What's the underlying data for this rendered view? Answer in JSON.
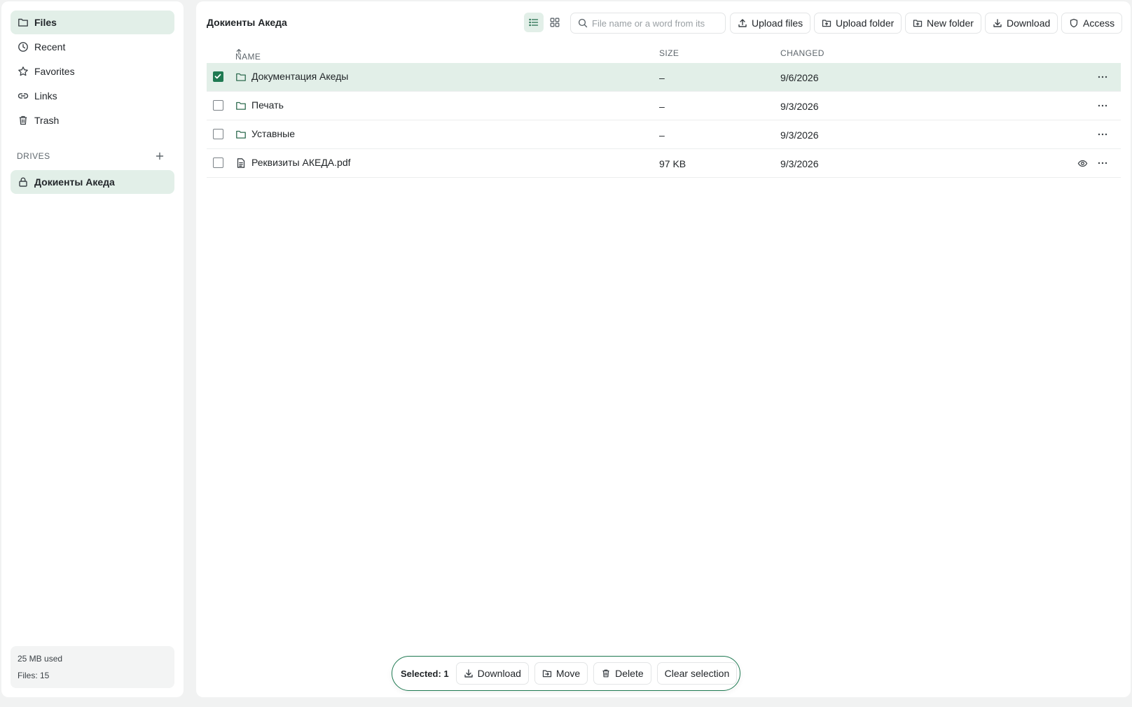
{
  "sidebar": {
    "nav": [
      {
        "label": "Files",
        "icon": "folder-icon",
        "active": true
      },
      {
        "label": "Recent",
        "icon": "clock-icon",
        "active": false
      },
      {
        "label": "Favorites",
        "icon": "star-icon",
        "active": false
      },
      {
        "label": "Links",
        "icon": "link-icon",
        "active": false
      },
      {
        "label": "Trash",
        "icon": "trash-icon",
        "active": false
      }
    ],
    "drives_label": "DRIVES",
    "drives": [
      {
        "label": "Докиенты Акеда",
        "icon": "lock-icon",
        "active": true
      }
    ],
    "storage": {
      "used": "25 MB used",
      "files": "Files: 15"
    }
  },
  "main": {
    "title": "Докиенты Акеда",
    "search_placeholder": "File name or a word from its",
    "toolbar": {
      "upload_files": "Upload files",
      "upload_folder": "Upload folder",
      "new_folder": "New folder",
      "download": "Download",
      "access": "Access"
    },
    "columns": {
      "name": "NAME",
      "size": "SIZE",
      "changed": "CHANGED"
    },
    "rows": [
      {
        "name": "Документация Акеды",
        "type": "folder",
        "size": "–",
        "changed": "9/6/2026",
        "selected": true
      },
      {
        "name": "Печать",
        "type": "folder",
        "size": "–",
        "changed": "9/3/2026",
        "selected": false
      },
      {
        "name": "Уставные",
        "type": "folder",
        "size": "–",
        "changed": "9/3/2026",
        "selected": false
      },
      {
        "name": "Реквизиты АКЕДА.pdf",
        "type": "file",
        "size": "97 KB",
        "changed": "9/3/2026",
        "selected": false
      }
    ]
  },
  "selection_bar": {
    "count": "Selected: 1",
    "download": "Download",
    "move": "Move",
    "delete": "Delete",
    "clear": "Clear selection"
  },
  "colors": {
    "accent": "#1f7a52",
    "selected_bg": "#e2efe8",
    "page_bg": "#f1f2f2"
  }
}
